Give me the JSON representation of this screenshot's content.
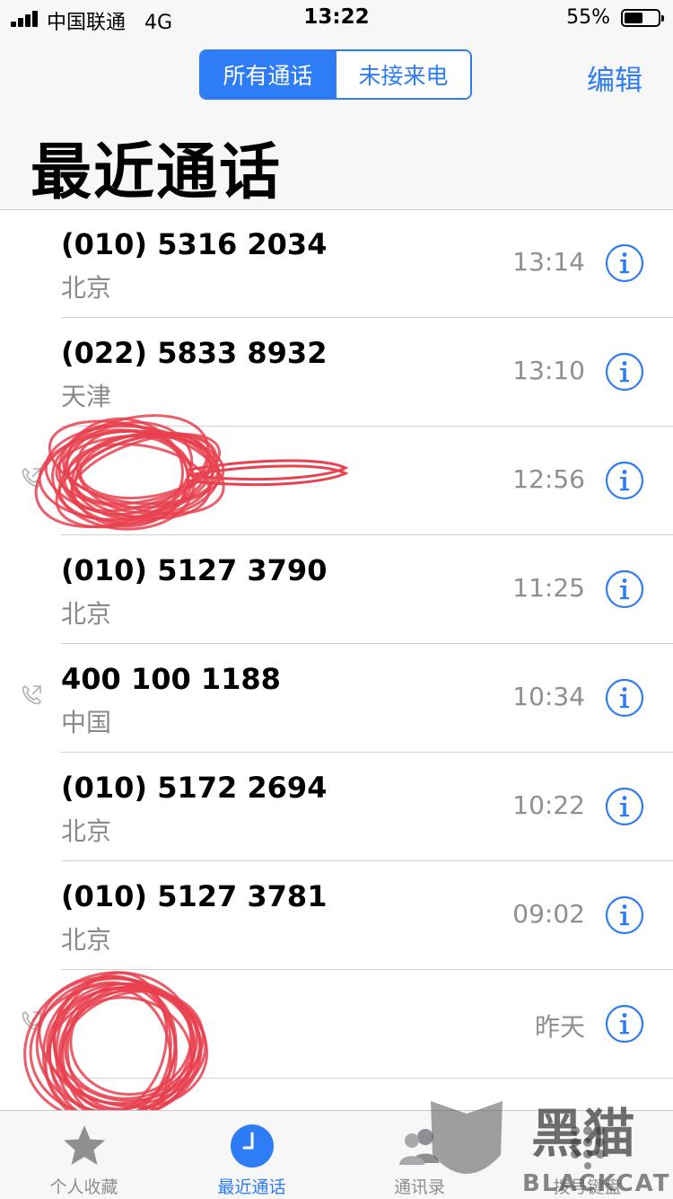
{
  "status_bar": {
    "carrier": "中国联通",
    "network": "4G",
    "time": "13:22",
    "battery_percent": "55%",
    "battery_level": 0.55
  },
  "header": {
    "segments": [
      {
        "label": "所有通话",
        "selected": true
      },
      {
        "label": "未接来电",
        "selected": false
      }
    ],
    "edit_label": "编辑",
    "title": "最近通话"
  },
  "calls": [
    {
      "number": "(010) 5316 2034",
      "location": "北京",
      "time": "13:14",
      "outgoing": false
    },
    {
      "number": "(022) 5833 8932",
      "location": "天津",
      "time": "13:10",
      "outgoing": false
    },
    {
      "number": "",
      "location": "",
      "time": "12:56",
      "outgoing": true,
      "redacted": true
    },
    {
      "number": "(010) 5127 3790",
      "location": "北京",
      "time": "11:25",
      "outgoing": false
    },
    {
      "number": "400 100 1188",
      "location": "中国",
      "time": "10:34",
      "outgoing": true
    },
    {
      "number": "(010) 5172 2694",
      "location": "北京",
      "time": "10:22",
      "outgoing": false
    },
    {
      "number": "(010) 5127 3781",
      "location": "北京",
      "time": "09:02",
      "outgoing": false
    },
    {
      "number": "",
      "location": "",
      "time": "昨天",
      "outgoing": true,
      "redacted": true
    }
  ],
  "tabbar": {
    "tabs": [
      {
        "label": "个人收藏",
        "icon": "star-icon",
        "active": false
      },
      {
        "label": "最近通话",
        "icon": "clock-icon",
        "active": true
      },
      {
        "label": "通讯录",
        "icon": "contacts-icon",
        "active": false
      },
      {
        "label": "拨号键盘",
        "icon": "keypad-icon",
        "active": false
      }
    ]
  },
  "watermark": {
    "brand_cn": "黑猫",
    "brand_en": "BLACKCAT"
  },
  "colors": {
    "accent": "#2d7cf6",
    "secondary_text": "#8e8e93",
    "scribble": "#e8414f"
  }
}
